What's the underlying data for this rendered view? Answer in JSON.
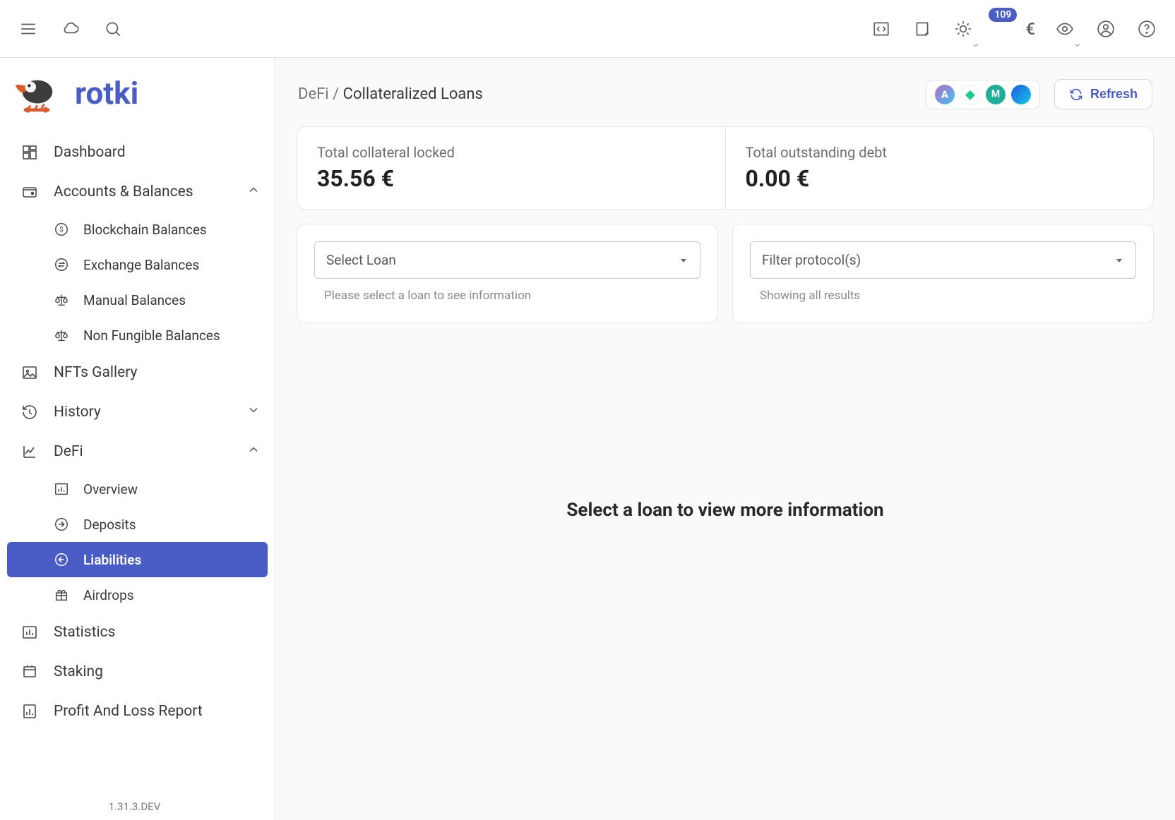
{
  "brand": {
    "name": "rotki"
  },
  "topbar": {
    "notification_count": "109",
    "currency_symbol": "€"
  },
  "sidebar": {
    "version": "1.31.3.DEV",
    "items": [
      {
        "label": "Dashboard"
      },
      {
        "label": "Accounts & Balances"
      },
      {
        "label": "NFTs Gallery"
      },
      {
        "label": "History"
      },
      {
        "label": "DeFi"
      },
      {
        "label": "Statistics"
      },
      {
        "label": "Staking"
      },
      {
        "label": "Profit And Loss Report"
      }
    ],
    "accounts_sub": [
      {
        "label": "Blockchain Balances"
      },
      {
        "label": "Exchange Balances"
      },
      {
        "label": "Manual Balances"
      },
      {
        "label": "Non Fungible Balances"
      }
    ],
    "defi_sub": [
      {
        "label": "Overview"
      },
      {
        "label": "Deposits"
      },
      {
        "label": "Liabilities"
      },
      {
        "label": "Airdrops"
      }
    ]
  },
  "breadcrumb": {
    "parent": "DeFi",
    "sep": " / ",
    "current": "Collateralized Loans"
  },
  "refresh_label": "Refresh",
  "stats": {
    "collateral": {
      "label": "Total collateral locked",
      "value": "35.56 €"
    },
    "debt": {
      "label": "Total outstanding debt",
      "value": "0.00 €"
    }
  },
  "loan_select": {
    "placeholder": "Select Loan",
    "helper": "Please select a loan to see information"
  },
  "protocol_filter": {
    "placeholder": "Filter protocol(s)",
    "helper": "Showing all results"
  },
  "empty_message": "Select a loan to view more information"
}
